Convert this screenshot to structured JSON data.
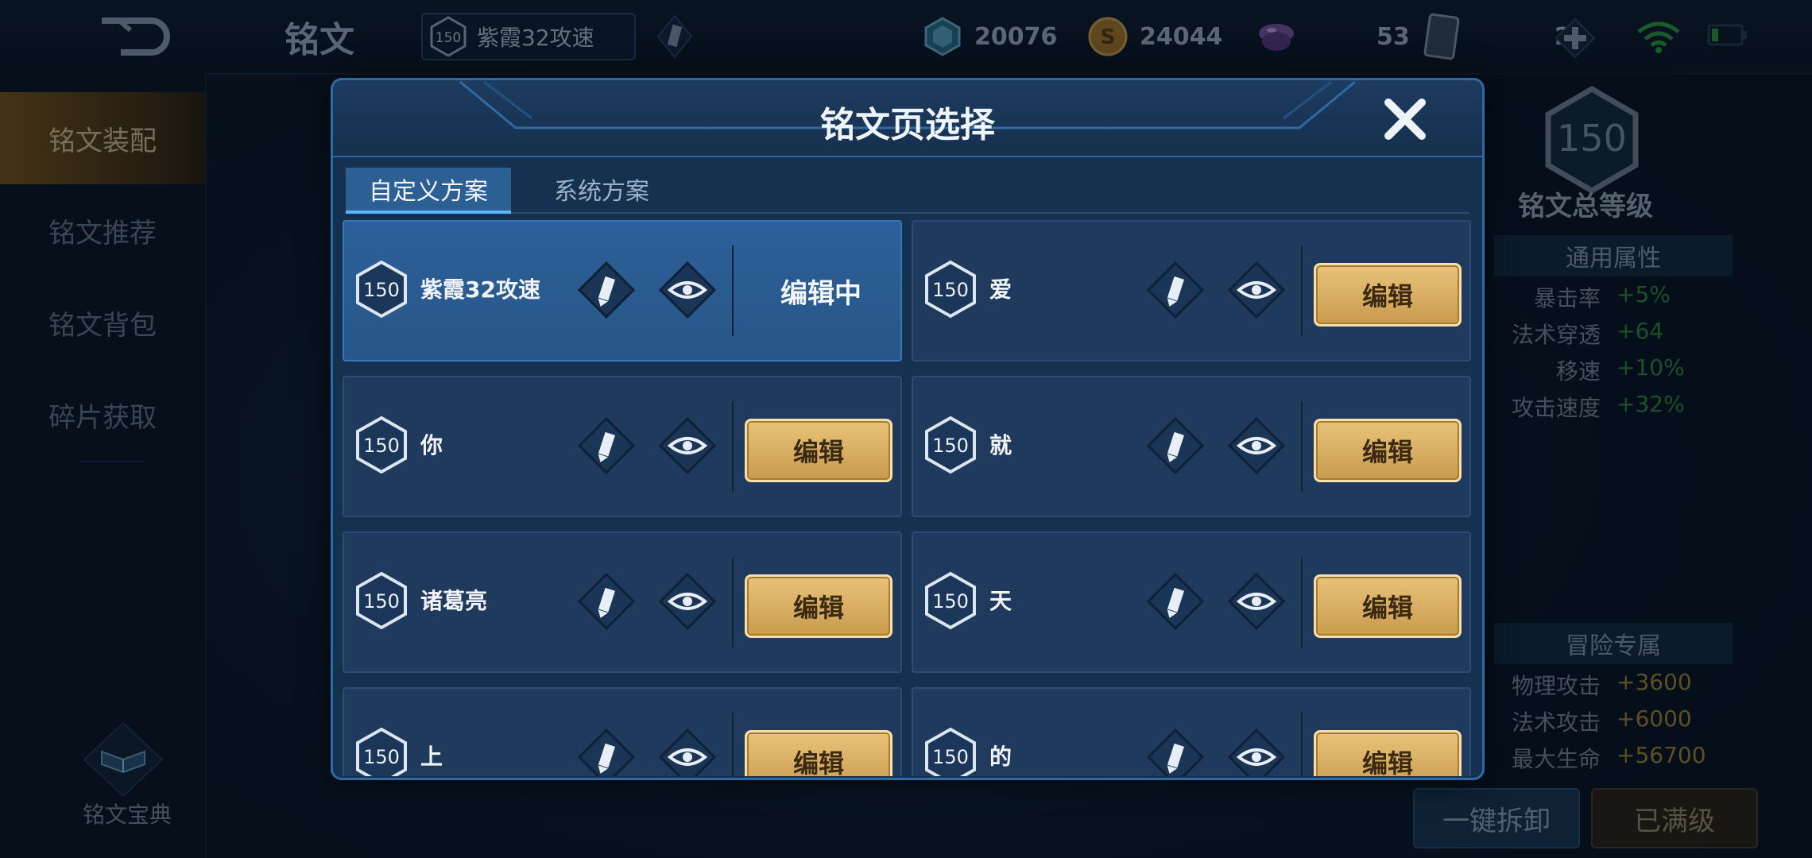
{
  "header": {
    "title": "铭文",
    "current_page_level": "150",
    "current_page_name": "紫霞32攻速",
    "currencies": [
      {
        "icon": "crystal-gem-icon",
        "value": "20076"
      },
      {
        "icon": "gold-coin-icon",
        "value": "24044"
      },
      {
        "icon": "diamond-icon",
        "value": "53"
      },
      {
        "icon": "card-icon",
        "value": "2"
      }
    ]
  },
  "sidebar": {
    "items": [
      {
        "label": "铭文装配",
        "active": true
      },
      {
        "label": "铭文推荐"
      },
      {
        "label": "铭文背包"
      },
      {
        "label": "碎片获取"
      }
    ],
    "codex_label": "铭文宝典"
  },
  "stats": {
    "total_level": "150",
    "total_label": "铭文总等级",
    "general_title": "通用属性",
    "general": [
      {
        "name": "暴击率",
        "value": "+5%"
      },
      {
        "name": "法术穿透",
        "value": "+64"
      },
      {
        "name": "移速",
        "value": "+10%"
      },
      {
        "name": "攻击速度",
        "value": "+32%"
      }
    ],
    "adventure_title": "冒险专属",
    "adventure": [
      {
        "name": "物理攻击",
        "value": "+3600"
      },
      {
        "name": "法术攻击",
        "value": "+6000"
      },
      {
        "name": "最大生命",
        "value": "+56700"
      }
    ],
    "btn_unload": "一键拆卸",
    "btn_maxed": "已满级"
  },
  "modal": {
    "title": "铭文页选择",
    "tabs": [
      "自定义方案",
      "系统方案"
    ],
    "editing_label": "编辑中",
    "edit_label": "编辑",
    "pages": [
      {
        "level": "150",
        "name": "紫霞32攻速",
        "current": true
      },
      {
        "level": "150",
        "name": "爱"
      },
      {
        "level": "150",
        "name": "你"
      },
      {
        "level": "150",
        "name": "就"
      },
      {
        "level": "150",
        "name": "诸葛亮"
      },
      {
        "level": "150",
        "name": "天"
      },
      {
        "level": "150",
        "name": "上"
      },
      {
        "level": "150",
        "name": "的"
      }
    ]
  }
}
